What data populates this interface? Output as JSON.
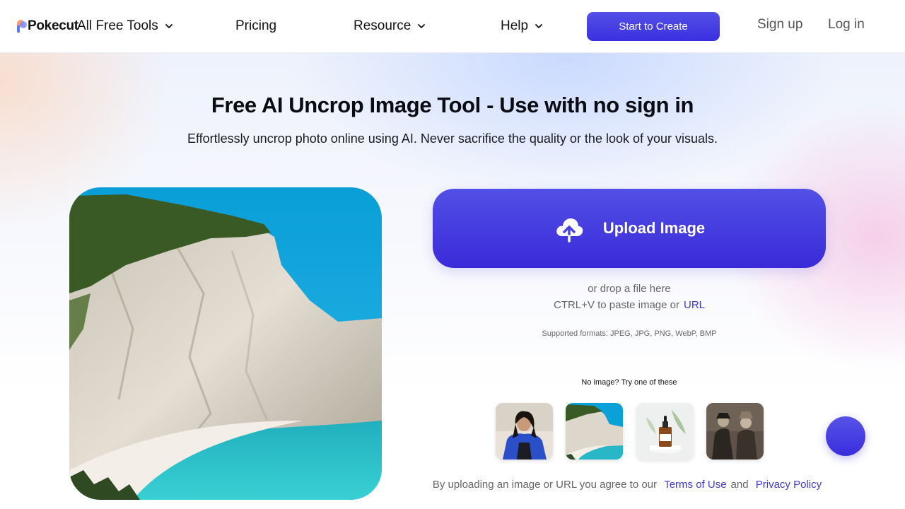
{
  "header": {
    "logo_text": "Pokecut",
    "nav": {
      "tools": "All Free Tools",
      "pricing": "Pricing",
      "resource": "Resource",
      "help": "Help"
    },
    "start_button": "Start to Create",
    "signup": "Sign up",
    "login": "Log in"
  },
  "hero": {
    "title": "Free AI Uncrop Image Tool - Use with no sign in",
    "subtitle": "Effortlessly uncrop photo online using AI. Never sacrifice the quality or the look of your visuals."
  },
  "upload": {
    "button_label": "Upload Image",
    "drop_text": "or drop a file here",
    "paste_text": "CTRL+V to paste image or",
    "url_link": "URL",
    "formats": "Supported formats: JPEG, JPG, PNG, WebP, BMP",
    "try_text": "No image? Try one of these"
  },
  "terms": {
    "prefix": "By uploading an image or URL you agree to our",
    "terms_link": "Terms of Use",
    "and": "and",
    "privacy_link": "Privacy Policy"
  },
  "colors": {
    "accent": "#3d3ad1",
    "button_gradient_top": "#5450e6",
    "button_gradient_bottom": "#3a2fe0"
  }
}
